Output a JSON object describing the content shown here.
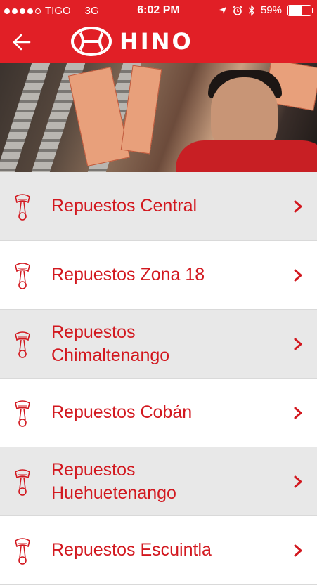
{
  "status": {
    "carrier": "TIGO",
    "network": "3G",
    "time": "6:02 PM",
    "battery": "59%"
  },
  "header": {
    "brand": "HINO",
    "back_icon": "back-arrow-icon"
  },
  "colors": {
    "brand_red": "#e11f26",
    "label_red": "#d2181f",
    "row_gray": "#e8e8e8"
  },
  "items": [
    {
      "label": "Repuestos Central",
      "icon": "piston-icon",
      "action_icon": "chevron-right-icon"
    },
    {
      "label": "Repuestos Zona 18",
      "icon": "piston-icon",
      "action_icon": "chevron-right-icon"
    },
    {
      "label": "Repuestos Chimaltenango",
      "icon": "piston-icon",
      "action_icon": "chevron-right-icon"
    },
    {
      "label": "Repuestos Cobán",
      "icon": "piston-icon",
      "action_icon": "chevron-right-icon"
    },
    {
      "label": "Repuestos Huehuetenango",
      "icon": "piston-icon",
      "action_icon": "chevron-right-icon"
    },
    {
      "label": "Repuestos Escuintla",
      "icon": "piston-icon",
      "action_icon": "chevron-right-icon"
    }
  ]
}
